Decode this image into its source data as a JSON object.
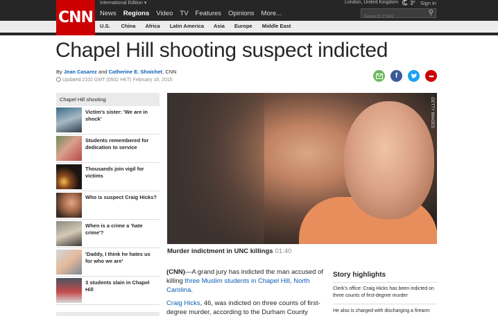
{
  "header": {
    "logo": "CNN",
    "edition": "International Edition",
    "nav": [
      "News",
      "Regions",
      "Video",
      "TV",
      "Features",
      "Opinions",
      "More..."
    ],
    "active_nav": "Regions",
    "location": "London, United Kingdom",
    "temperature": "3°",
    "sign_in": "Sign in",
    "search_placeholder": "Search CNN",
    "regions": [
      "U.S.",
      "China",
      "Africa",
      "Latin America",
      "Asia",
      "Europe",
      "Middle East"
    ]
  },
  "article": {
    "headline": "Chapel Hill shooting suspect indicted",
    "by": "By",
    "author1": "Jean Casarez",
    "and": "and",
    "author2": "Catherine E. Shoichet",
    "outlet": ", CNN",
    "updated": "Updated 2102 GMT (0502 HKT) February 16, 2015",
    "image_credit": "GETTY IMAGES",
    "caption_title": "Murder indictment in UNC killings",
    "caption_duration": "01:40",
    "p1_prefix": "(CNN)",
    "p1_text_a": "—A grand jury has indicted the man accused of killing ",
    "p1_link": "three Muslim students in Chapel Hill, North Carolina",
    "p1_text_b": ".",
    "p2_link": "Craig Hicks",
    "p2_text": ", 46, was indicted on three counts of first-degree murder, according to the Durham County"
  },
  "share": {
    "email_color": "#6cb85d",
    "facebook_color": "#3b5998",
    "twitter_color": "#1da1f2",
    "more_color": "#cc0000"
  },
  "sidebar": {
    "title": "Chapel Hill shooting",
    "items": [
      {
        "label": "Victim's sister: 'We are in shock'"
      },
      {
        "label": "Students remembered for dedication to service"
      },
      {
        "label": "Thousands join vigil for victims"
      },
      {
        "label": "Who is suspect Craig Hicks?"
      },
      {
        "label": "When is a crime a 'hate crime'?"
      },
      {
        "label": "'Daddy, I think he hates us for who we are'"
      },
      {
        "label": "3 students slain in Chapel Hill"
      }
    ]
  },
  "highlights": {
    "title": "Story highlights",
    "items": [
      "Clerk's office: Craig Hicks has been indicted on three counts of first-degree murder",
      "He also is charged with discharging a firearm"
    ]
  }
}
